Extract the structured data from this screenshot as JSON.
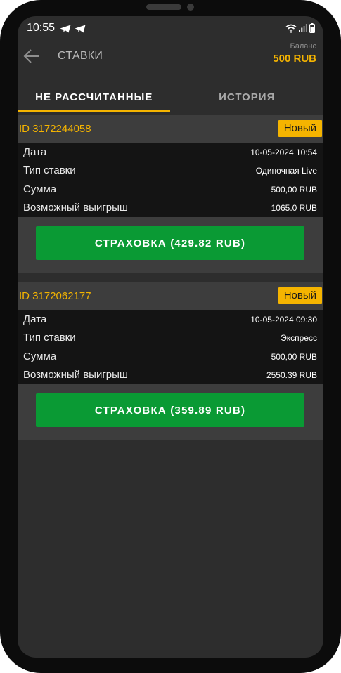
{
  "status": {
    "time": "10:55"
  },
  "header": {
    "title": "СТАВКИ",
    "balance_label": "Баланс",
    "balance_value": "500 RUB"
  },
  "tabs": [
    {
      "label": "НЕ РАССЧИТАННЫЕ",
      "active": true
    },
    {
      "label": "ИСТОРИЯ",
      "active": false
    }
  ],
  "bets": [
    {
      "id": "ID 3172244058",
      "badge": "Новый",
      "rows": [
        {
          "label": "Дата",
          "value": "10-05-2024 10:54"
        },
        {
          "label": "Тип ставки",
          "value": "Одиночная Live"
        },
        {
          "label": "Сумма",
          "value": "500,00 RUB"
        },
        {
          "label": "Возможный выигрыш",
          "value": "1065.0 RUB"
        }
      ],
      "insurance_button": "СТРАХОВКА (429.82 RUB)"
    },
    {
      "id": "ID 3172062177",
      "badge": "Новый",
      "rows": [
        {
          "label": "Дата",
          "value": "10-05-2024 09:30"
        },
        {
          "label": "Тип ставки",
          "value": "Экспресс"
        },
        {
          "label": "Сумма",
          "value": "500,00 RUB"
        },
        {
          "label": "Возможный выигрыш",
          "value": "2550.39 RUB"
        }
      ],
      "insurance_button": "СТРАХОВКА (359.89 RUB)"
    }
  ],
  "colors": {
    "accent": "#f5b400",
    "button": "#0a9a34",
    "background": "#2d2d2d",
    "card_body": "#141414"
  },
  "icons": {
    "back": "arrow-left-icon",
    "telegram": "telegram-icon",
    "wifi": "wifi-icon",
    "signal": "signal-icon",
    "battery": "battery-icon"
  }
}
